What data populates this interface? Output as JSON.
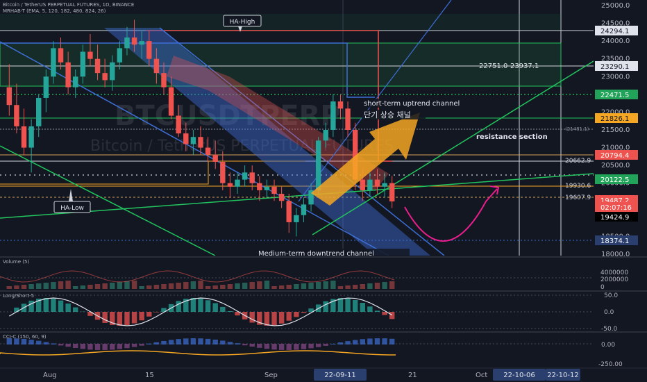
{
  "header": {
    "symbol_line": "Bitcoin / TetherUS PERPETUAL FUTURES, 1D, BINANCE",
    "indicator_line": "MRHAB-T (EMA, 5, 120, 182, 480, 824, 26)"
  },
  "watermark": {
    "ticker": "BTCUSDTPERP",
    "name": "Bitcoin / TetherUS PERPETUAL FUTURES"
  },
  "annotations": {
    "ha_high": "HA-High",
    "ha_low": "HA-Low",
    "short_term_en": "short-term uptrend channel",
    "short_term_ko": "단기 상승 채널",
    "resistance": "resistance section",
    "medium_term": "Medium-term downtrend channel",
    "range_label": "22751.0-23937.1",
    "level_21481": "(21481.1)",
    "level_20662": "20662.9",
    "level_19930": "19930.6",
    "level_19607": "19607.9"
  },
  "colors": {
    "background": "#131722",
    "green": "#26a69a",
    "red": "#ef5350",
    "bright_green": "#22c55e",
    "line_green": "#4caf50",
    "blue": "#3d6fd6",
    "orange": "#f5a623",
    "magenta": "#e91e8c",
    "white": "#e0e3eb"
  },
  "price_axis": {
    "ticks": [
      "25000.0",
      "24500.0",
      "24000.0",
      "23500.0",
      "23000.0",
      "22500.0",
      "22000.0",
      "21500.0",
      "21000.0",
      "20500.0",
      "20000.0",
      "19500.0",
      "19000.0",
      "18500.0",
      "18000.0"
    ],
    "badges": [
      {
        "label": "24294.1",
        "style": "white"
      },
      {
        "label": "23290.1",
        "style": "white"
      },
      {
        "label": "22471.5",
        "style": "green"
      },
      {
        "label": "21826.1",
        "style": "orange"
      },
      {
        "label": "20794.4",
        "style": "red"
      },
      {
        "label": "20122.5",
        "style": "green"
      },
      {
        "label": "19487.2",
        "style": "red"
      },
      {
        "label": "02:07:16",
        "style": "red"
      },
      {
        "label": "19424.9",
        "style": "black"
      },
      {
        "label": "18374.1",
        "style": "blue"
      }
    ]
  },
  "panels": {
    "volume": {
      "title": "Volume (5)",
      "ticks": [
        "4000000",
        "2000000",
        "0"
      ]
    },
    "longshort": {
      "title": "Long/Short-5",
      "ticks": [
        "50.0",
        "0.0",
        "-50.0"
      ]
    },
    "ccic": {
      "title": "CCI-C (150, 60, 9)",
      "ticks": [
        "0.00",
        "-250.00"
      ]
    }
  },
  "time_axis": {
    "ticks": [
      "Aug",
      "15",
      "Sep",
      "21",
      "Oct"
    ],
    "highlights": [
      "22-09-11",
      "22-10-06",
      "22-10-12"
    ]
  },
  "chart_data": {
    "type": "candlestick",
    "title": "Bitcoin / TetherUS PERPETUAL FUTURES, 1D, BINANCE",
    "ylim": [
      18000,
      25000
    ],
    "candles": [
      [
        22700,
        23350,
        21900,
        22200
      ],
      [
        22200,
        22800,
        21400,
        21600
      ],
      [
        21600,
        22100,
        20800,
        21000
      ],
      [
        21000,
        21800,
        20300,
        21600
      ],
      [
        21600,
        22500,
        21300,
        22400
      ],
      [
        22400,
        23200,
        22000,
        23000
      ],
      [
        23000,
        24000,
        22800,
        23800
      ],
      [
        23800,
        24100,
        23200,
        23400
      ],
      [
        23400,
        23700,
        22500,
        22700
      ],
      [
        22700,
        23200,
        22400,
        23000
      ],
      [
        23000,
        23900,
        22800,
        23700
      ],
      [
        23700,
        24200,
        23300,
        23500
      ],
      [
        23500,
        23900,
        22900,
        23100
      ],
      [
        23100,
        23500,
        22700,
        22900
      ],
      [
        22900,
        23600,
        22600,
        23400
      ],
      [
        23400,
        24000,
        23200,
        23800
      ],
      [
        23800,
        24400,
        23600,
        24100
      ],
      [
        24100,
        24600,
        23700,
        23900
      ],
      [
        23900,
        24300,
        23500,
        24000
      ],
      [
        24000,
        24300,
        23300,
        23500
      ],
      [
        23500,
        23800,
        22800,
        23100
      ],
      [
        23100,
        23400,
        22500,
        22700
      ],
      [
        22700,
        23000,
        21800,
        21900
      ],
      [
        21900,
        22200,
        21300,
        21400
      ],
      [
        21400,
        21700,
        20900,
        21100
      ],
      [
        21100,
        21500,
        20800,
        21300
      ],
      [
        21300,
        21600,
        20800,
        21000
      ],
      [
        21000,
        21300,
        20600,
        20800
      ],
      [
        20800,
        21200,
        20400,
        20600
      ],
      [
        20600,
        20900,
        19800,
        20000
      ],
      [
        20000,
        20300,
        19600,
        19900
      ],
      [
        19900,
        20300,
        19700,
        20100
      ],
      [
        20100,
        20500,
        19900,
        20300
      ],
      [
        20300,
        20500,
        19800,
        20000
      ],
      [
        20000,
        20200,
        19500,
        19800
      ],
      [
        19800,
        20100,
        19600,
        19900
      ],
      [
        19900,
        20100,
        19500,
        19700
      ],
      [
        19700,
        19900,
        19300,
        19500
      ],
      [
        19500,
        19700,
        18600,
        18900
      ],
      [
        18900,
        19300,
        18500,
        19100
      ],
      [
        19100,
        19600,
        18900,
        19400
      ],
      [
        19400,
        20000,
        19200,
        19800
      ],
      [
        19800,
        21300,
        19700,
        21200
      ],
      [
        21200,
        21700,
        21000,
        21500
      ],
      [
        21500,
        22500,
        21300,
        22300
      ],
      [
        22300,
        22500,
        21800,
        22100
      ],
      [
        22100,
        22300,
        21300,
        21500
      ],
      [
        21500,
        21700,
        19800,
        20100
      ],
      [
        20100,
        20400,
        19500,
        19800
      ],
      [
        19800,
        20300,
        19600,
        20100
      ],
      [
        20100,
        20400,
        19700,
        19900
      ],
      [
        19900,
        20300,
        19600,
        20000
      ],
      [
        20000,
        20200,
        19300,
        19487
      ]
    ],
    "levels": [
      24294.1,
      23290.1,
      22471.5,
      21826.1,
      20794.4,
      20122.5,
      19487.2,
      19424.9,
      18374.1
    ]
  }
}
